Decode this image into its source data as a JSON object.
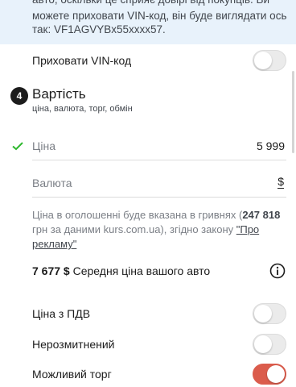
{
  "vin_notice": {
    "line1": "авто, оскільки це сприяє довірі від покупців. Ви",
    "line2": "можете приховати VIN-код, він буде виглядати ось",
    "line3": "так: VF1AGVYBx55xxxx57."
  },
  "hide_vin": {
    "label": "Приховати VIN-код",
    "enabled": false
  },
  "section": {
    "step": "4",
    "title": "Вартість",
    "subtitle": "ціна, валюта, торг, обмін"
  },
  "price_field": {
    "label": "Ціна",
    "value": "5 999"
  },
  "currency_field": {
    "label": "Валюта",
    "symbol": "$"
  },
  "conversion_note": {
    "text_before": "Ціна в оголошенні буде вказана в гривнях (",
    "uah_amount": "247 818",
    "text_middle": " грн за даними kurs.com.ua), згідно закону ",
    "link_label": "\"Про рекламу\""
  },
  "average_price": {
    "amount": "7 677 $",
    "label": "Середня ціна вашого авто"
  },
  "options": [
    {
      "label": "Ціна з ПДВ",
      "enabled": false
    },
    {
      "label": "Нерозмитнений",
      "enabled": false
    },
    {
      "label": "Можливий торг",
      "enabled": true
    }
  ],
  "colors": {
    "accent": "#db5c4c",
    "check": "#2eb82e",
    "info_bg": "#e8f2fb"
  }
}
